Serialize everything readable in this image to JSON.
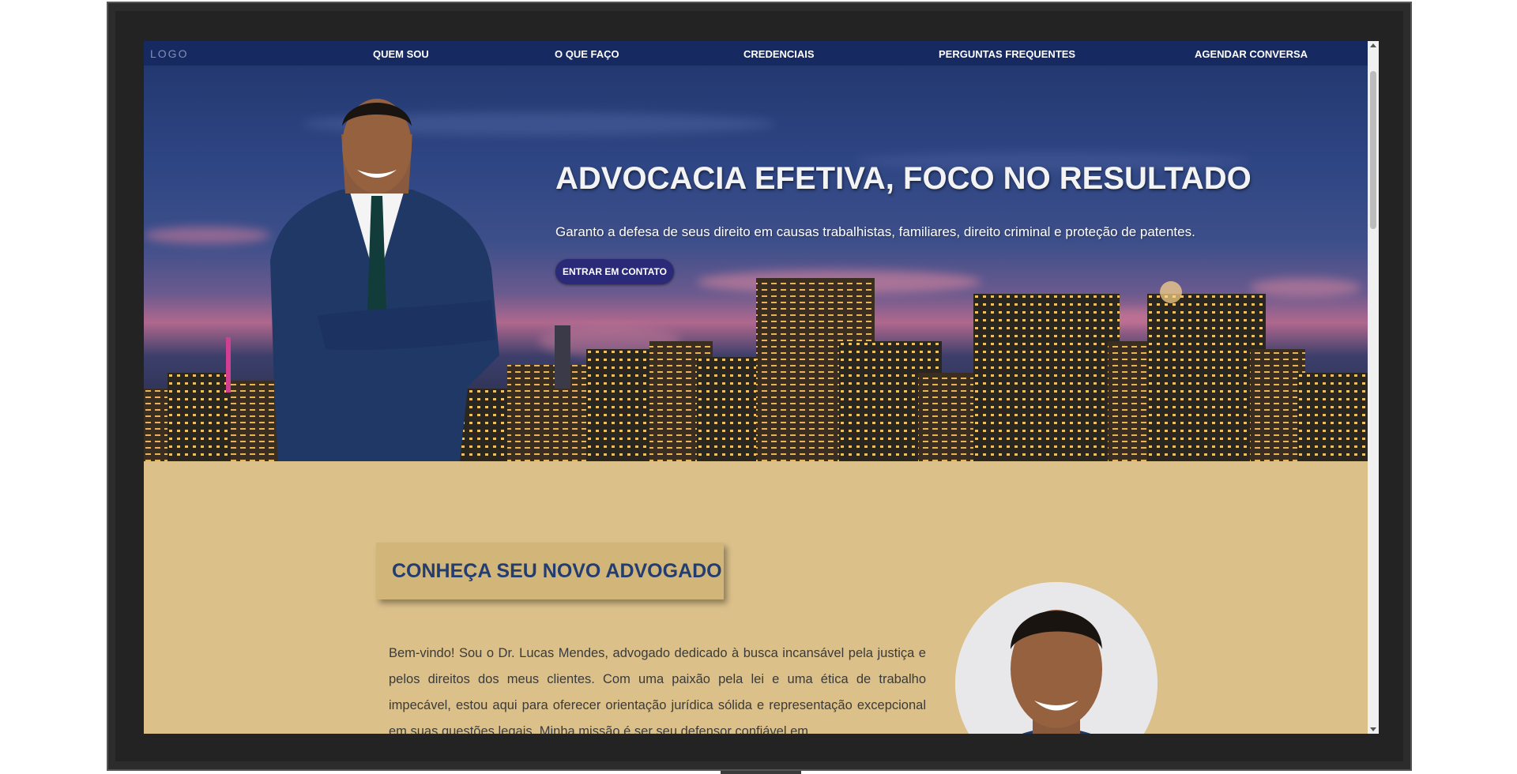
{
  "nav": {
    "logo": "LOGO",
    "links": [
      "QUEM SOU",
      "O QUE FAÇO",
      "CREDENCIAIS",
      "PERGUNTAS FREQUENTES",
      "AGENDAR CONVERSA"
    ]
  },
  "hero": {
    "title": "ADVOCACIA EFETIVA, FOCO NO RESULTADO",
    "subtitle": "Garanto a defesa de seus direito em causas trabalhistas, familiares, direito criminal e proteção de patentes.",
    "cta_label": "ENTRAR EM CONTATO"
  },
  "about": {
    "title": "CONHEÇA SEU NOVO ADVOGADO",
    "text": "Bem-vindo! Sou o Dr. Lucas Mendes, advogado dedicado à busca incansável pela justiça e pelos direitos dos meus clientes. Com uma paixão pela lei e uma ética de trabalho impecável, estou aqui para oferecer orientação jurídica sólida e representação excepcional em suas questões legais. Minha missão é ser seu defensor confiável em"
  },
  "colors": {
    "nav_bg": "#14285f",
    "cta_bg": "#2a2a78",
    "about_bg": "#dbc08a",
    "about_tag_bg": "#d2b679",
    "about_title": "#233d70"
  }
}
